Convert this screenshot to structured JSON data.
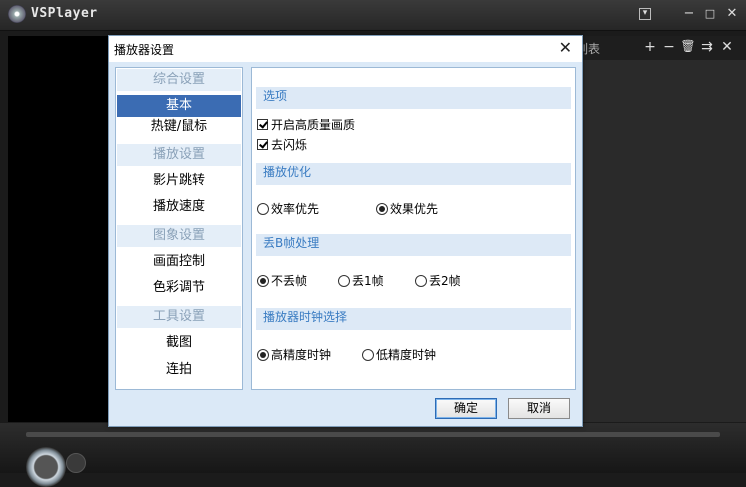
{
  "app": {
    "title": "VSPlayer"
  },
  "playlist": {
    "title": "列表"
  },
  "dialog": {
    "title": "播放器设置",
    "nav": {
      "categories": [
        "综合设置",
        "播放设置",
        "图象设置",
        "工具设置"
      ],
      "items": [
        "基本",
        "热键/鼠标",
        "影片跳转",
        "播放速度",
        "画面控制",
        "色彩调节",
        "截图",
        "连拍"
      ],
      "active": "基本"
    },
    "sections": {
      "options": {
        "title": "选项",
        "hq_label": "开启高质量画质",
        "hq_checked": true,
        "deflicker_label": "去闪烁",
        "deflicker_checked": true
      },
      "optimize": {
        "title": "播放优化",
        "efficiency_label": "效率优先",
        "quality_label": "效果优先",
        "selected": "效果优先"
      },
      "frame_drop": {
        "title": "丢B帧处理",
        "none_label": "不丢帧",
        "drop1_label": "丢1帧",
        "drop2_label": "丢2帧",
        "selected": "不丢帧"
      },
      "clock": {
        "title": "播放器时钟选择",
        "high_label": "高精度时钟",
        "low_label": "低精度时钟",
        "selected": "高精度时钟"
      }
    },
    "ok_label": "确定",
    "cancel_label": "取消"
  },
  "colors": {
    "accent": "#3b6cb3",
    "section_text": "#3a7cc2",
    "dialog_bg": "#dbe9f7"
  }
}
